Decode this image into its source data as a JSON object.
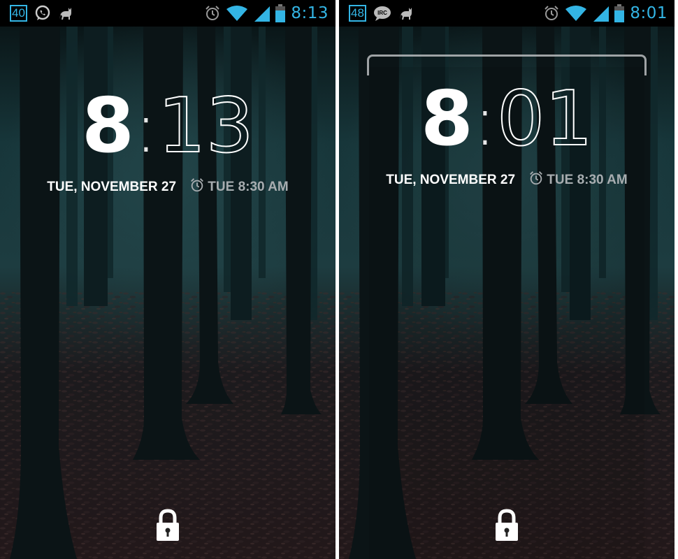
{
  "left_screen": {
    "status_bar": {
      "notification_count": "40",
      "time": "8:13",
      "left_icons": [
        "whatsapp-icon",
        "cat-icon"
      ],
      "right_icons": [
        "alarm-icon",
        "wifi-icon",
        "signal-icon",
        "battery-icon"
      ]
    },
    "clock": {
      "hour": "8",
      "separator": ":",
      "minutes": "13"
    },
    "date": "TUE, NOVEMBER 27",
    "alarm": "TUE 8:30 AM",
    "unlock_icon": "lock-icon"
  },
  "right_screen": {
    "status_bar": {
      "notification_count": "48",
      "time": "8:01",
      "left_icons": [
        "irc-icon",
        "cat-icon"
      ],
      "right_icons": [
        "alarm-icon",
        "wifi-icon",
        "signal-icon",
        "battery-icon"
      ]
    },
    "clock": {
      "hour": "8",
      "separator": ":",
      "minutes": "01"
    },
    "date": "TUE, NOVEMBER 27",
    "alarm": "TUE 8:30 AM",
    "unlock_icon": "lock-icon"
  },
  "colors": {
    "status_accent": "#33b5e5",
    "alarm_text": "#a8adb0",
    "status_bar_bg": "#000000"
  }
}
